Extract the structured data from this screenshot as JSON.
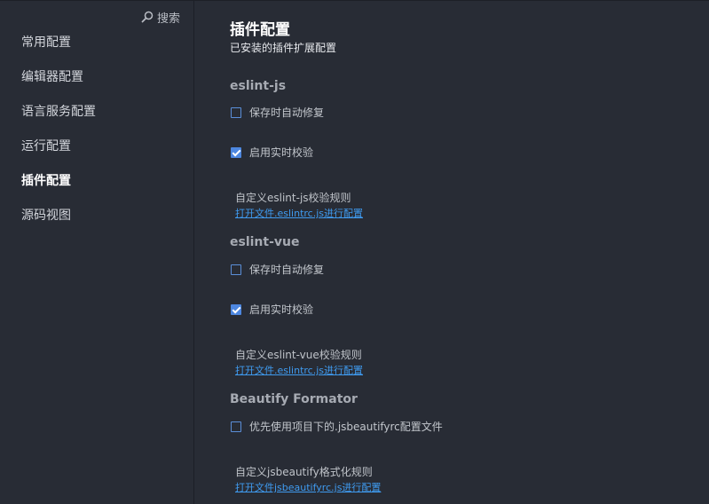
{
  "sidebar": {
    "search_label": "搜索",
    "items": [
      {
        "label": "常用配置",
        "active": false
      },
      {
        "label": "编辑器配置",
        "active": false
      },
      {
        "label": "语言服务配置",
        "active": false
      },
      {
        "label": "运行配置",
        "active": false
      },
      {
        "label": "插件配置",
        "active": true
      },
      {
        "label": "源码视图",
        "active": false
      }
    ]
  },
  "main": {
    "title": "插件配置",
    "subtitle": "已安装的插件扩展配置",
    "sections": [
      {
        "title": "eslint-js",
        "checkboxes": [
          {
            "label": "保存时自动修复",
            "checked": false
          },
          {
            "label": "启用实时校验",
            "checked": true
          }
        ],
        "rule_label": "自定义eslint-js校验规则",
        "rule_link": "打开文件.eslintrc.js进行配置"
      },
      {
        "title": "eslint-vue",
        "checkboxes": [
          {
            "label": "保存时自动修复",
            "checked": false
          },
          {
            "label": "启用实时校验",
            "checked": true
          }
        ],
        "rule_label": "自定义eslint-vue校验规则",
        "rule_link": "打开文件.eslintrc.js进行配置"
      },
      {
        "title": "Beautify Formator",
        "checkboxes": [
          {
            "label": "优先使用项目下的.jsbeautifyrc配置文件",
            "checked": false
          }
        ],
        "rule_label": "自定义jsbeautify格式化规则",
        "rule_link": "打开文件jsbeautifyrc.js进行配置"
      }
    ]
  },
  "colors": {
    "background": "#282c35",
    "accent": "#4d87e0",
    "link": "#3f9bf0"
  }
}
